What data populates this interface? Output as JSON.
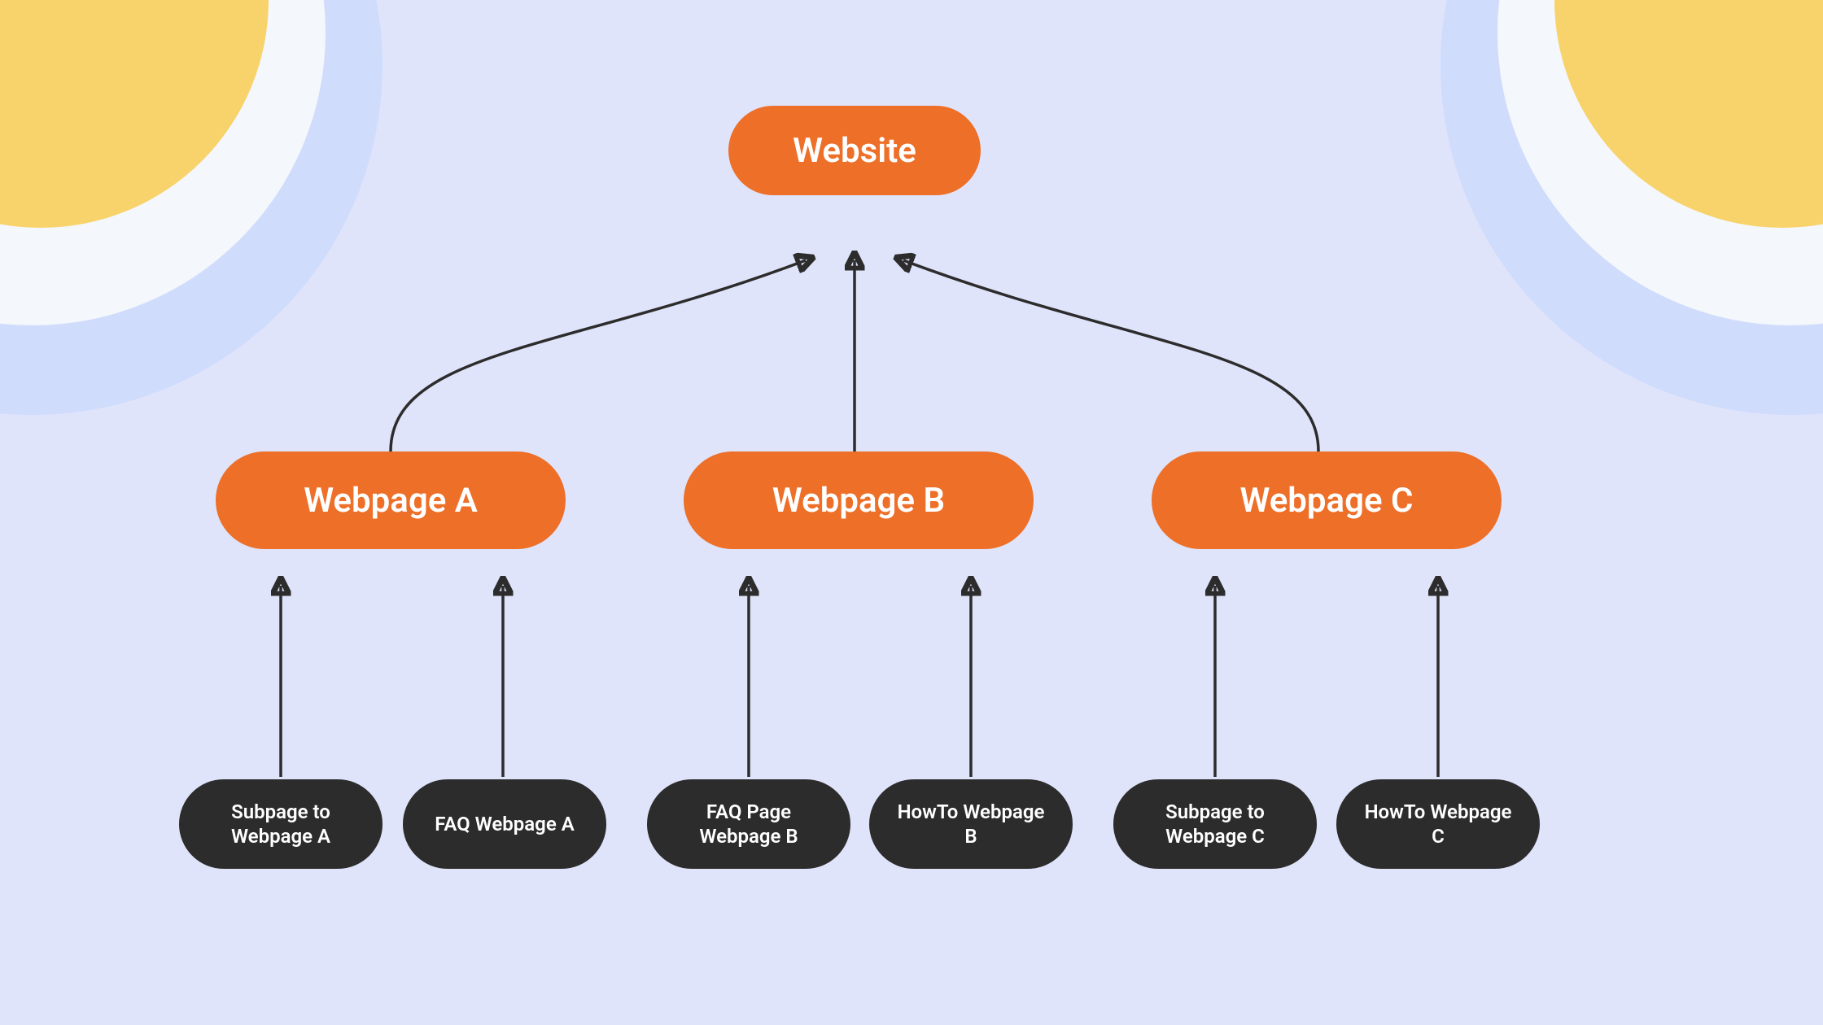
{
  "colors": {
    "background": "#dfe4fb",
    "accent_orange": "#ed6f28",
    "leaf_dark": "#2d2c2c",
    "corner_yellow": "#f8d26a",
    "corner_white": "#f4f7fb",
    "corner_blue": "#cfdcfc"
  },
  "root": {
    "label": "Website"
  },
  "mids": {
    "a": {
      "label": "Webpage A"
    },
    "b": {
      "label": "Webpage B"
    },
    "c": {
      "label": "Webpage C"
    }
  },
  "leaves": {
    "a1": {
      "label": "Subpage to Webpage A"
    },
    "a2": {
      "label": "FAQ Webpage A"
    },
    "b1": {
      "label": "FAQ Page Webpage B"
    },
    "b2": {
      "label": "HowTo Webpage B"
    },
    "c1": {
      "label": "Subpage to Webpage C"
    },
    "c2": {
      "label": "HowTo Webpage C"
    }
  },
  "chart_data": {
    "type": "tree",
    "direction": "bottom-up",
    "nodes": [
      {
        "id": "root",
        "label": "Website",
        "level": 0,
        "color": "orange"
      },
      {
        "id": "A",
        "label": "Webpage A",
        "level": 1,
        "color": "orange"
      },
      {
        "id": "B",
        "label": "Webpage B",
        "level": 1,
        "color": "orange"
      },
      {
        "id": "C",
        "label": "Webpage C",
        "level": 1,
        "color": "orange"
      },
      {
        "id": "A1",
        "label": "Subpage to Webpage A",
        "level": 2,
        "color": "dark"
      },
      {
        "id": "A2",
        "label": "FAQ Webpage A",
        "level": 2,
        "color": "dark"
      },
      {
        "id": "B1",
        "label": "FAQ Page Webpage B",
        "level": 2,
        "color": "dark"
      },
      {
        "id": "B2",
        "label": "HowTo Webpage B",
        "level": 2,
        "color": "dark"
      },
      {
        "id": "C1",
        "label": "Subpage to Webpage C",
        "level": 2,
        "color": "dark"
      },
      {
        "id": "C2",
        "label": "HowTo Webpage C",
        "level": 2,
        "color": "dark"
      }
    ],
    "edges": [
      {
        "from": "A",
        "to": "root"
      },
      {
        "from": "B",
        "to": "root"
      },
      {
        "from": "C",
        "to": "root"
      },
      {
        "from": "A1",
        "to": "A"
      },
      {
        "from": "A2",
        "to": "A"
      },
      {
        "from": "B1",
        "to": "B"
      },
      {
        "from": "B2",
        "to": "B"
      },
      {
        "from": "C1",
        "to": "C"
      },
      {
        "from": "C2",
        "to": "C"
      }
    ]
  }
}
